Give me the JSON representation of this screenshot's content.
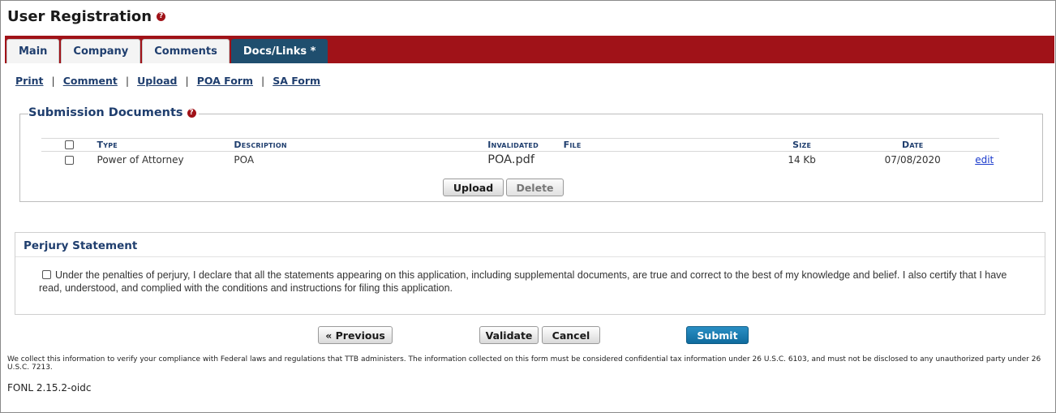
{
  "page": {
    "title": "User Registration"
  },
  "tabs": [
    {
      "label": "Main"
    },
    {
      "label": "Company"
    },
    {
      "label": "Comments"
    },
    {
      "label": "Docs/Links *"
    }
  ],
  "subnav": [
    "Print",
    "Comment",
    "Upload",
    "POA Form",
    "SA Form"
  ],
  "documents": {
    "title": "Submission Documents",
    "columns": {
      "type": "Type",
      "description": "Description",
      "invalidated": "Invalidated",
      "file": "File",
      "size": "Size",
      "date": "Date"
    },
    "rows": [
      {
        "type": "Power of Attorney",
        "description": "POA",
        "file": "POA.pdf",
        "size": "14 Kb",
        "date": "07/08/2020",
        "edit": "edit"
      }
    ],
    "upload_label": "Upload",
    "delete_label": "Delete"
  },
  "perjury": {
    "title": "Perjury Statement",
    "text": "Under the penalties of perjury, I declare that all the statements appearing on this application, including supplemental documents, are true and correct to the best of my knowledge and belief. I also certify that I have read, understood, and complied with the conditions and instructions for filing this application."
  },
  "actions": {
    "previous": "« Previous",
    "validate": "Validate",
    "cancel": "Cancel",
    "submit": "Submit"
  },
  "footer": {
    "note": "We collect this information to verify your compliance with Federal laws and regulations that TTB administers. The information collected on this form must be considered confidential tax information under 26 U.S.C. 6103, and must not be disclosed to any unauthorized party under 26 U.S.C. 7213.",
    "version": "FONL 2.15.2-oidc"
  },
  "colors": {
    "brand_red": "#a01218",
    "nav_blue": "#1f3e6e",
    "active_tab": "#1f4e6e",
    "submit_blue": "#0f6b9e"
  }
}
